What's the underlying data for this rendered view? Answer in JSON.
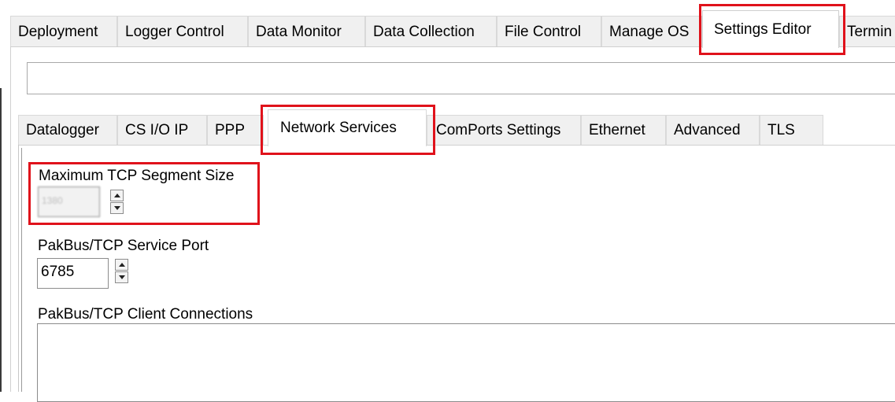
{
  "top_tabs": [
    "Deployment",
    "Logger Control",
    "Data Monitor",
    "Data Collection",
    "File Control",
    "Manage OS",
    "Settings Editor",
    "Termin"
  ],
  "selected_top_tab": "Settings Editor",
  "sub_tabs": [
    "Datalogger",
    "CS I/O IP",
    "PPP",
    "Network Services",
    "ComPorts Settings",
    "Ethernet",
    "Advanced",
    "TLS"
  ],
  "selected_sub_tab": "Network Services",
  "fields": {
    "max_tcp_segment": {
      "label": "Maximum TCP Segment Size",
      "value": "1380"
    },
    "pakbus_tcp_port": {
      "label": "PakBus/TCP Service Port",
      "value": "6785"
    },
    "pakbus_client_connections": {
      "label": "PakBus/TCP Client Connections",
      "value": ""
    }
  },
  "colors": {
    "highlight": "#e0121b",
    "tab_bg": "#f0f0f0",
    "selected_tab_bg": "#ffffff"
  }
}
